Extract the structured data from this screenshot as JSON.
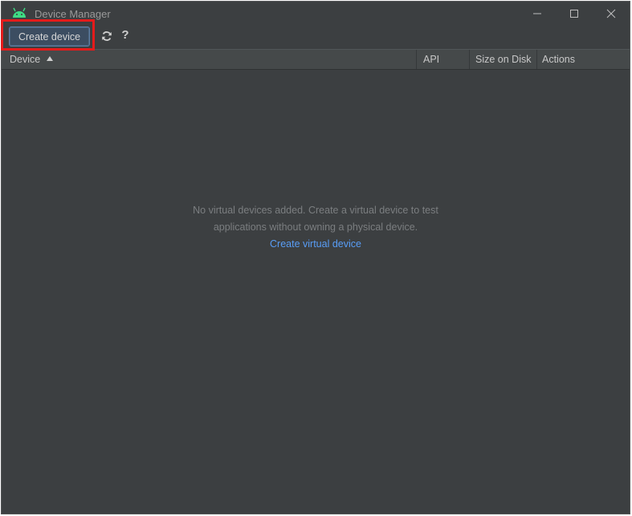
{
  "window": {
    "title": "Device Manager"
  },
  "toolbar": {
    "create_label": "Create device",
    "refresh_icon": "refresh-icon",
    "help_label": "?"
  },
  "table": {
    "columns": [
      {
        "label": "Device",
        "sort": "ascending"
      },
      {
        "label": "API"
      },
      {
        "label": "Size on Disk"
      },
      {
        "label": "Actions"
      }
    ]
  },
  "empty_state": {
    "line1": "No virtual devices added. Create a virtual device to test",
    "line2": "applications without owning a physical device.",
    "link": "Create virtual device"
  },
  "colors": {
    "background": "#3c3f41",
    "accent_link": "#589df6",
    "highlight": "#e41b1b",
    "android_green": "#3ddc84"
  }
}
